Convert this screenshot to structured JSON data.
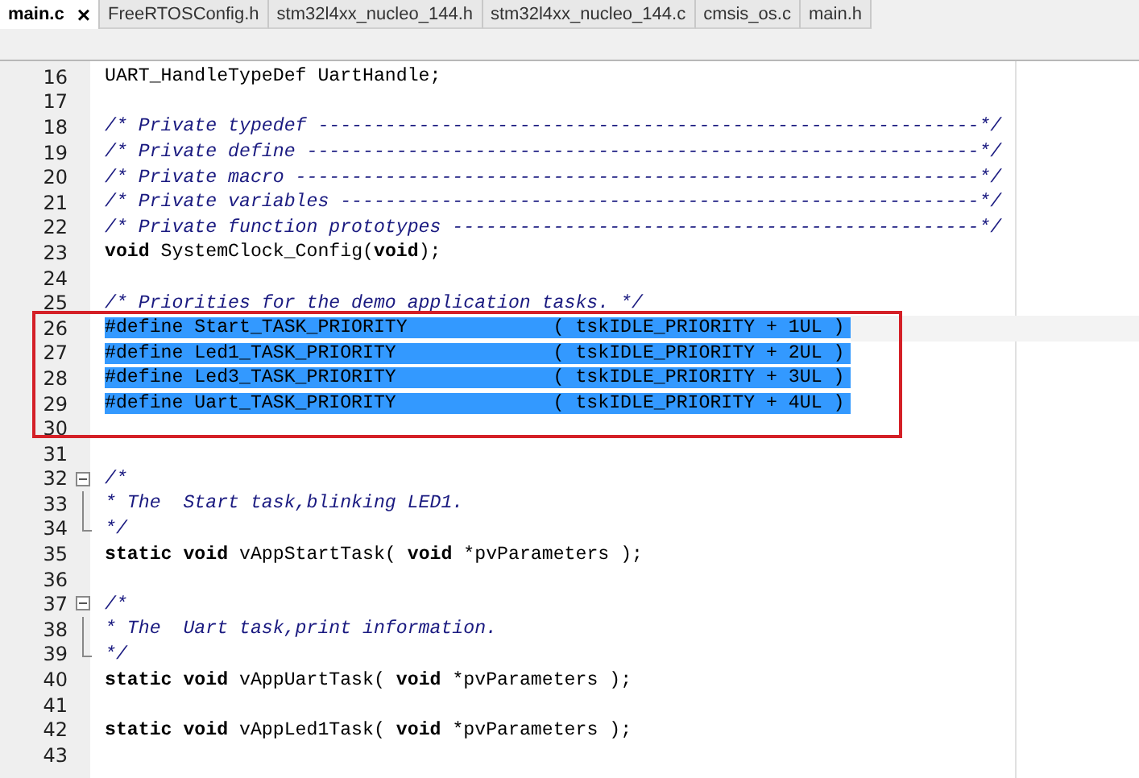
{
  "tabs": [
    {
      "label": "main.c",
      "selected": true,
      "closable": true,
      "close": "×"
    },
    {
      "label": "FreeRTOSConfig.h",
      "selected": false,
      "closable": false
    },
    {
      "label": "stm32l4xx_nucleo_144.h",
      "selected": false,
      "closable": false
    },
    {
      "label": "stm32l4xx_nucleo_144.c",
      "selected": false,
      "closable": false
    },
    {
      "label": "cmsis_os.c",
      "selected": false,
      "closable": false
    },
    {
      "label": "main.h",
      "selected": false,
      "closable": false
    }
  ],
  "lines": [
    {
      "number": "16",
      "segments": [
        {
          "text": "UART_HandleTypeDef UartHandle;",
          "kind": "plain"
        }
      ]
    },
    {
      "number": "17"
    },
    {
      "number": "18",
      "segments": [
        {
          "text": "/* Private typedef -----------------------------------------------------------*/",
          "kind": "comment"
        }
      ]
    },
    {
      "number": "19",
      "segments": [
        {
          "text": "/* Private define ------------------------------------------------------------*/",
          "kind": "comment"
        }
      ]
    },
    {
      "number": "20",
      "segments": [
        {
          "text": "/* Private macro -------------------------------------------------------------*/",
          "kind": "comment"
        }
      ]
    },
    {
      "number": "21",
      "segments": [
        {
          "text": "/* Private variables ---------------------------------------------------------*/",
          "kind": "comment"
        }
      ]
    },
    {
      "number": "22",
      "segments": [
        {
          "text": "/* Private function prototypes -----------------------------------------------*/",
          "kind": "comment"
        }
      ]
    },
    {
      "number": "23",
      "segments": [
        {
          "text": "void",
          "kind": "keyword"
        },
        {
          "text": " SystemClock_Config(",
          "kind": "plain"
        },
        {
          "text": "void",
          "kind": "keyword"
        },
        {
          "text": ");",
          "kind": "plain"
        }
      ]
    },
    {
      "number": "24"
    },
    {
      "number": "25",
      "segments": [
        {
          "text": "/* Priorities for the demo application tasks. */",
          "kind": "comment"
        }
      ]
    },
    {
      "number": "26",
      "current": true,
      "selected": true,
      "boxed": true,
      "segments": [
        {
          "text": "#define Start_TASK_PRIORITY             ( tskIDLE_PRIORITY + 1UL )",
          "kind": "plain"
        }
      ]
    },
    {
      "number": "27",
      "selected": true,
      "boxed": true,
      "segments": [
        {
          "text": "#define Led1_TASK_PRIORITY              ( tskIDLE_PRIORITY + 2UL )",
          "kind": "plain"
        }
      ]
    },
    {
      "number": "28",
      "selected": true,
      "boxed": true,
      "segments": [
        {
          "text": "#define Led3_TASK_PRIORITY              ( tskIDLE_PRIORITY + 3UL )",
          "kind": "plain"
        }
      ]
    },
    {
      "number": "29",
      "selected": true,
      "boxed": true,
      "segments": [
        {
          "text": "#define Uart_TASK_PRIORITY              ( tskIDLE_PRIORITY + 4UL )",
          "kind": "plain"
        }
      ]
    },
    {
      "number": "30",
      "boxed": true
    },
    {
      "number": "31"
    },
    {
      "number": "32",
      "fold": {
        "kind": "start"
      },
      "segments": [
        {
          "text": "/*",
          "kind": "comment"
        }
      ]
    },
    {
      "number": "33",
      "fold": {
        "kind": "mid"
      },
      "segments": [
        {
          "text": "* The  Start task,blinking LED1.",
          "kind": "comment"
        }
      ]
    },
    {
      "number": "34",
      "fold": {
        "kind": "end"
      },
      "segments": [
        {
          "text": "*/",
          "kind": "comment"
        }
      ]
    },
    {
      "number": "35",
      "segments": [
        {
          "text": "static void",
          "kind": "keyword"
        },
        {
          "text": " vAppStartTask( ",
          "kind": "plain"
        },
        {
          "text": "void",
          "kind": "keyword"
        },
        {
          "text": " *pvParameters );",
          "kind": "plain"
        }
      ]
    },
    {
      "number": "36"
    },
    {
      "number": "37",
      "fold": {
        "kind": "start"
      },
      "segments": [
        {
          "text": "/*",
          "kind": "comment"
        }
      ]
    },
    {
      "number": "38",
      "fold": {
        "kind": "mid"
      },
      "segments": [
        {
          "text": "* The  Uart task,print information.",
          "kind": "comment"
        }
      ]
    },
    {
      "number": "39",
      "fold": {
        "kind": "end"
      },
      "segments": [
        {
          "text": "*/",
          "kind": "comment"
        }
      ]
    },
    {
      "number": "40",
      "segments": [
        {
          "text": "static void",
          "kind": "keyword"
        },
        {
          "text": " vAppUartTask( ",
          "kind": "plain"
        },
        {
          "text": "void",
          "kind": "keyword"
        },
        {
          "text": " *pvParameters );",
          "kind": "plain"
        }
      ]
    },
    {
      "number": "41"
    },
    {
      "number": "42",
      "segments": [
        {
          "text": "static void",
          "kind": "keyword"
        },
        {
          "text": " vAppLed1Task( ",
          "kind": "plain"
        },
        {
          "text": "void",
          "kind": "keyword"
        },
        {
          "text": " *pvParameters );",
          "kind": "plain"
        }
      ]
    },
    {
      "number": "43"
    }
  ]
}
